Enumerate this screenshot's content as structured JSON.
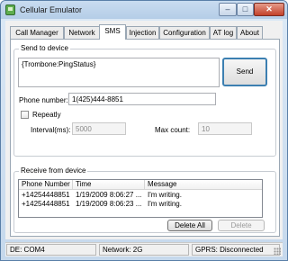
{
  "window": {
    "title": "Cellular Emulator"
  },
  "titlebar_buttons": {
    "minimize": "–",
    "maximize": "□",
    "close": "✕"
  },
  "tabs": [
    {
      "label": "Call Manager",
      "active": false
    },
    {
      "label": "Network",
      "active": false
    },
    {
      "label": "SMS",
      "active": true
    },
    {
      "label": "Injection",
      "active": false
    },
    {
      "label": "Configuration",
      "active": false
    },
    {
      "label": "AT log",
      "active": false
    },
    {
      "label": "About",
      "active": false
    }
  ],
  "send_group": {
    "label": "Send to device",
    "message_text": "{Trombone:PingStatus}",
    "send_button": "Send",
    "phone_label": "Phone number:",
    "phone_value": "1(425)444-8851",
    "repeatly_label": "Repeatly",
    "repeatly_checked": false,
    "interval_label": "Interval(ms):",
    "interval_value": "5000",
    "maxcount_label": "Max count:",
    "maxcount_value": "10"
  },
  "receive_group": {
    "label": "Receive from device",
    "columns": [
      "Phone Number",
      "Time",
      "Message"
    ],
    "rows": [
      [
        "+14254448851",
        "1/19/2009 8:06:27 ...",
        "I'm writing."
      ],
      [
        "+14254448851",
        "1/19/2009 8:06:23 ...",
        "I'm writing."
      ]
    ],
    "delete_all_button": "Delete All",
    "delete_button": "Delete"
  },
  "statusbar": {
    "de": "DE: COM4",
    "network": "Network: 2G",
    "gprs": "GPRS: Disconnected"
  },
  "colors": {
    "close_button": "#c3412a",
    "titlebar": "#c9dcf0",
    "default_button_border": "#3c7fb1"
  }
}
